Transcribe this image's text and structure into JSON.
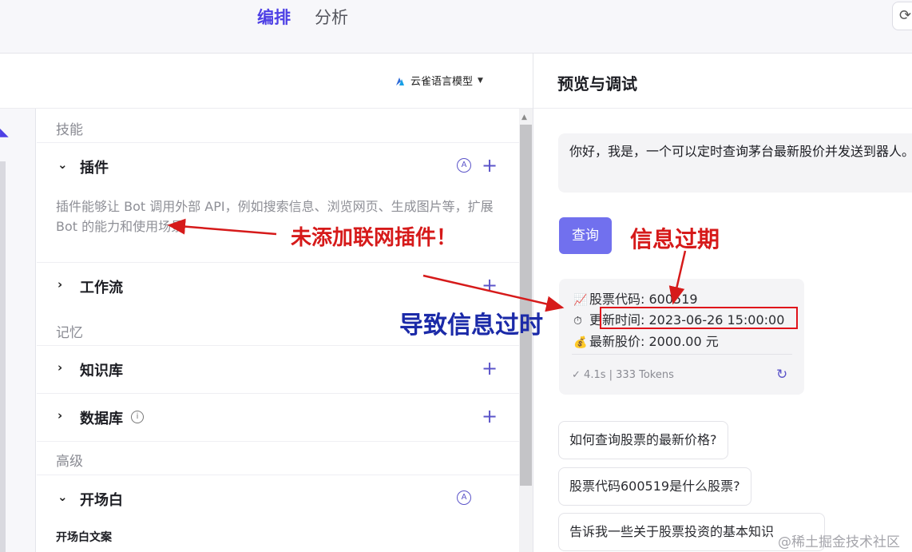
{
  "topbar": {
    "tabs": [
      {
        "label": "编排",
        "active": true
      },
      {
        "label": "分析",
        "active": false
      }
    ],
    "corner_icon": "refresh-icon"
  },
  "config": {
    "model": {
      "name": "云雀语言模型",
      "icon": "skylark-logo-icon"
    },
    "groups": {
      "skills": "技能",
      "memory": "记忆",
      "advanced": "高级"
    },
    "plugin": {
      "title": "插件",
      "description": "插件能够让 Bot 调用外部 API，例如搜索信息、浏览网页、生成图片等，扩展 Bot 的能力和使用场景"
    },
    "workflow": {
      "title": "工作流"
    },
    "knowledge": {
      "title": "知识库"
    },
    "database": {
      "title": "数据库"
    },
    "opening": {
      "title": "开场白",
      "sub_label": "开场白文案"
    },
    "accent_color": "#4e40e5"
  },
  "preview": {
    "title": "预览与调试",
    "greeting": "你好，我是，一个可以定时查询茅台最新股价并发送到器人。",
    "query_button": "查询",
    "stock": {
      "code_label": "股票代码: 600519",
      "time_label": "更新时间: 2023-06-26 15:00:00",
      "price_label": "最新股价: 2000.00 元",
      "latency": "4.1s",
      "tokens": "333 Tokens"
    },
    "suggestions": [
      "如何查询股票的最新价格?",
      "股票代码600519是什么股票?",
      "告诉我一些关于股票投资的基本知识"
    ]
  },
  "annotations": {
    "no_plugin": "未添加联网插件！",
    "expired": "信息过期",
    "cause": "导致信息过时",
    "color_red": "#d61a1a",
    "color_blue": "#1b2aa8"
  },
  "watermark": "@稀土掘金技术社区"
}
